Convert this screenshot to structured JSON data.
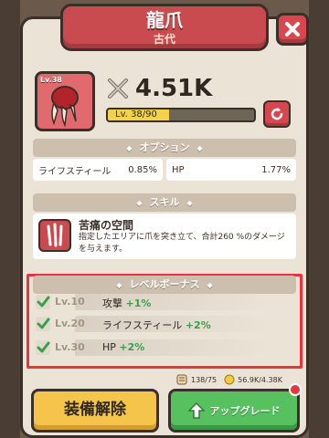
{
  "header": {
    "title": "龍爪",
    "subtitle": "古代"
  },
  "item": {
    "level_badge": "Lv.38",
    "power": "4.51K",
    "level_text": "Lv. 38/90",
    "level_progress": 0.42
  },
  "options": {
    "header": "オプション",
    "stats": [
      {
        "label": "ライフスティール",
        "value": "0.85%"
      },
      {
        "label": "HP",
        "value": "1.77%"
      }
    ]
  },
  "skill": {
    "header": "スキル",
    "name": "苦痛の空間",
    "description": "指定したエリアに爪を突き立て、合計260 %のダメージを与えます。"
  },
  "level_bonus": {
    "header": "レベルボーナス",
    "items": [
      {
        "level": "Lv.10",
        "stat": "攻撃",
        "value": "+1%"
      },
      {
        "level": "Lv.20",
        "stat": "ライフスティール",
        "value": "+2%"
      },
      {
        "level": "Lv.30",
        "stat": "HP",
        "value": "+2%"
      }
    ]
  },
  "resources": {
    "scrolls": "138/75",
    "gold": "56.9K/4.38K"
  },
  "buttons": {
    "unequip": "装備解除",
    "upgrade": "アップグレード"
  },
  "colors": {
    "banner": "#c94a4f",
    "unequip": "#f4c54a",
    "upgrade": "#56c15e",
    "bonus_highlight": "#e8343f",
    "bonus_value": "#35a24a"
  }
}
